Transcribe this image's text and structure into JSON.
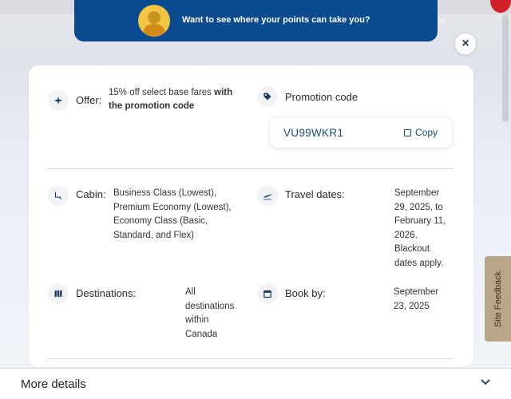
{
  "banner": {
    "text": "Want to see where your points can take you?",
    "chevron": ">"
  },
  "close_label": "×",
  "offer": {
    "label": "Offer:",
    "value_plain": "15% off select base fares ",
    "value_bold": "with the promotion code"
  },
  "promotion": {
    "label": "Promotion code",
    "code": "VU99WKR1",
    "copy_label": "Copy"
  },
  "cabin": {
    "label": "Cabin:",
    "lines": [
      "Business Class (Lowest),",
      "Premium Economy (Lowest),",
      "Economy Class (Basic,",
      "Standard, and Flex)"
    ]
  },
  "travel_dates": {
    "label": "Travel dates:",
    "lines": [
      "September",
      "29, 2025, to",
      "February 11,",
      "2026.",
      "Blackout",
      "dates apply."
    ]
  },
  "destinations": {
    "label": "Destinations:",
    "lines": [
      "All",
      "destinations",
      "within",
      "Canada"
    ]
  },
  "book_by": {
    "label": "Book by:",
    "lines": [
      "September",
      "23, 2025"
    ]
  },
  "site_feedback": "Site Feedback",
  "more_details": "More details",
  "colors": {
    "brand_blue": "#0a4a8f",
    "link_blue": "#1a4d7a",
    "feedback_tab": "#b9a58a"
  }
}
